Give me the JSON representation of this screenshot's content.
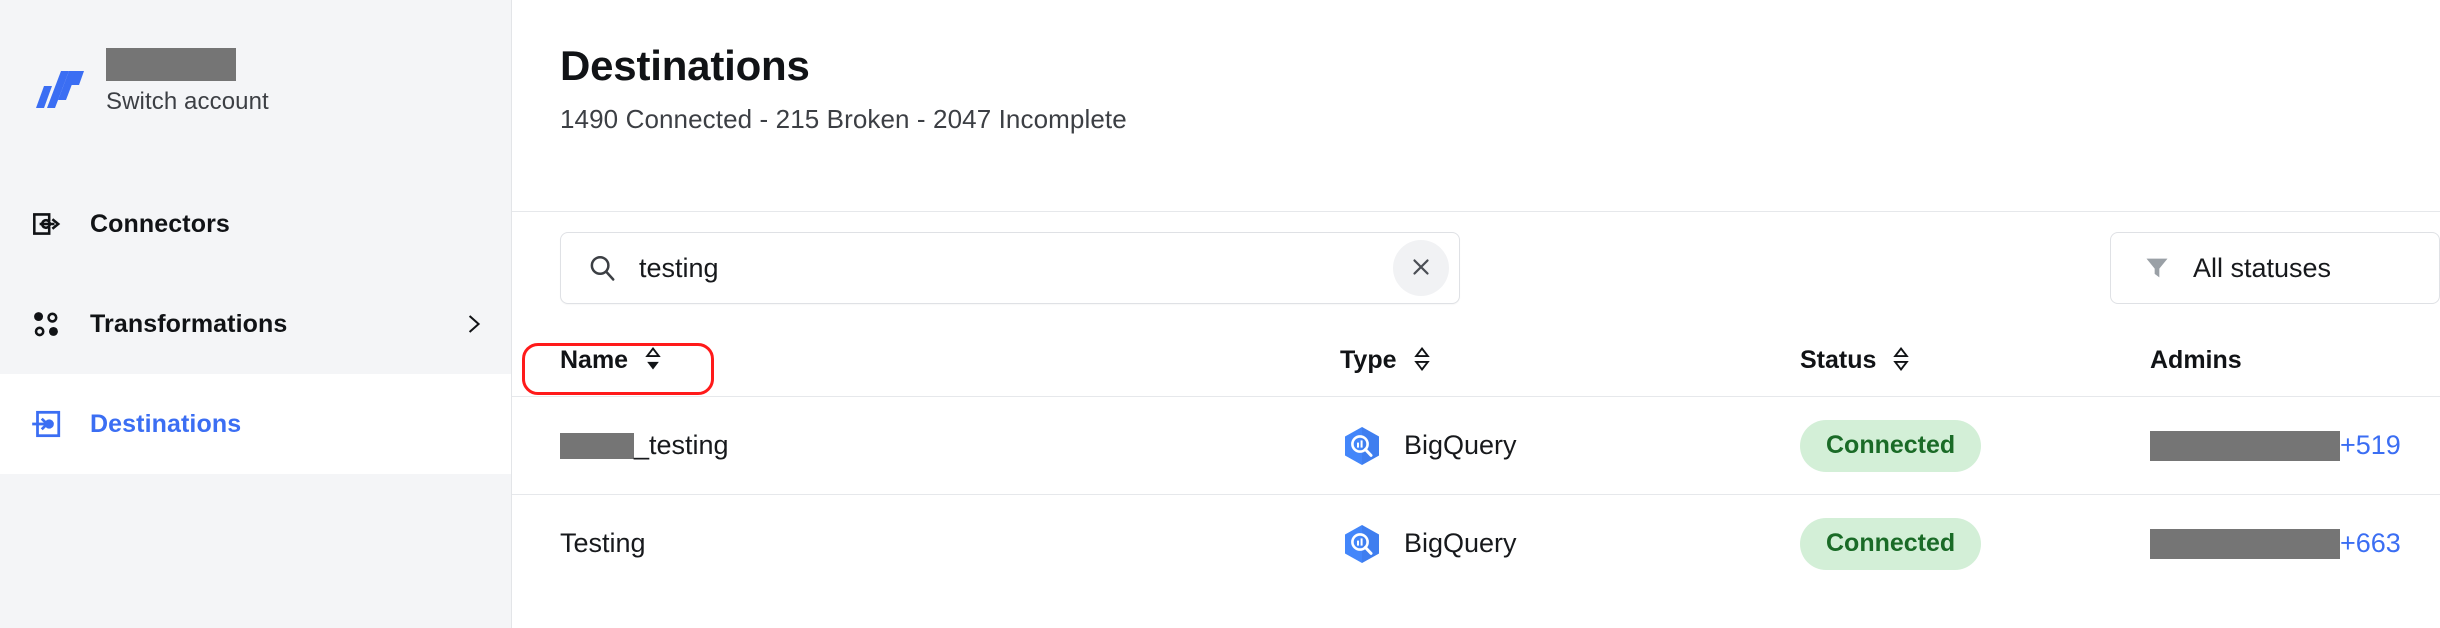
{
  "sidebar": {
    "account": {
      "logo_icon": "fivetran-logo",
      "account_name_redacted": true,
      "switch_account_label": "Switch account"
    },
    "items": [
      {
        "id": "connectors",
        "label": "Connectors",
        "icon": "connectors-icon",
        "active": false,
        "has_chevron": false
      },
      {
        "id": "transformations",
        "label": "Transformations",
        "icon": "transformations-icon",
        "active": false,
        "has_chevron": true,
        "chevron_icon": "chevron-right-icon"
      },
      {
        "id": "destinations",
        "label": "Destinations",
        "icon": "destinations-icon",
        "active": true,
        "has_chevron": false
      }
    ]
  },
  "header": {
    "title": "Destinations",
    "subtitle": "1490 Connected - 215 Broken - 2047 Incomplete",
    "counts": {
      "connected": 1490,
      "broken": 215,
      "incomplete": 2047
    }
  },
  "toolbar": {
    "search": {
      "icon": "search-icon",
      "value": "testing",
      "placeholder": "Search",
      "clear_icon": "close-icon",
      "clear_label": "×"
    },
    "filter": {
      "icon": "filter-icon",
      "label": "All statuses"
    }
  },
  "table": {
    "columns": [
      {
        "key": "name",
        "label": "Name",
        "sortable": true,
        "sort_icon": "sort-desc-icon"
      },
      {
        "key": "type",
        "label": "Type",
        "sortable": true,
        "sort_icon": "sort-none-icon"
      },
      {
        "key": "status",
        "label": "Status",
        "sortable": true,
        "sort_icon": "sort-none-icon"
      },
      {
        "key": "admins",
        "label": "Admins",
        "sortable": false,
        "sort_icon": ""
      }
    ],
    "rows": [
      {
        "name_prefix_redacted": true,
        "name": "_testing",
        "type_icon": "bigquery-icon",
        "type": "BigQuery",
        "status": "Connected",
        "status_color": "#1a6b27",
        "status_bg": "#d3efd7",
        "admins_redacted": true,
        "admins_more": "+519",
        "highlighted": false
      },
      {
        "name_prefix_redacted": false,
        "name": "Testing",
        "type_icon": "bigquery-icon",
        "type": "BigQuery",
        "status": "Connected",
        "status_color": "#1a6b27",
        "status_bg": "#d3efd7",
        "admins_redacted": true,
        "admins_more": "+663",
        "highlighted": true
      }
    ]
  },
  "colors": {
    "brand_blue": "#3b6ef3",
    "sidebar_bg": "#f4f5f7",
    "link_blue": "#3b6ef3",
    "annotation_red": "#ff1a1a",
    "redaction_gray": "#757575",
    "bigquery_blue": "#4386fa"
  }
}
